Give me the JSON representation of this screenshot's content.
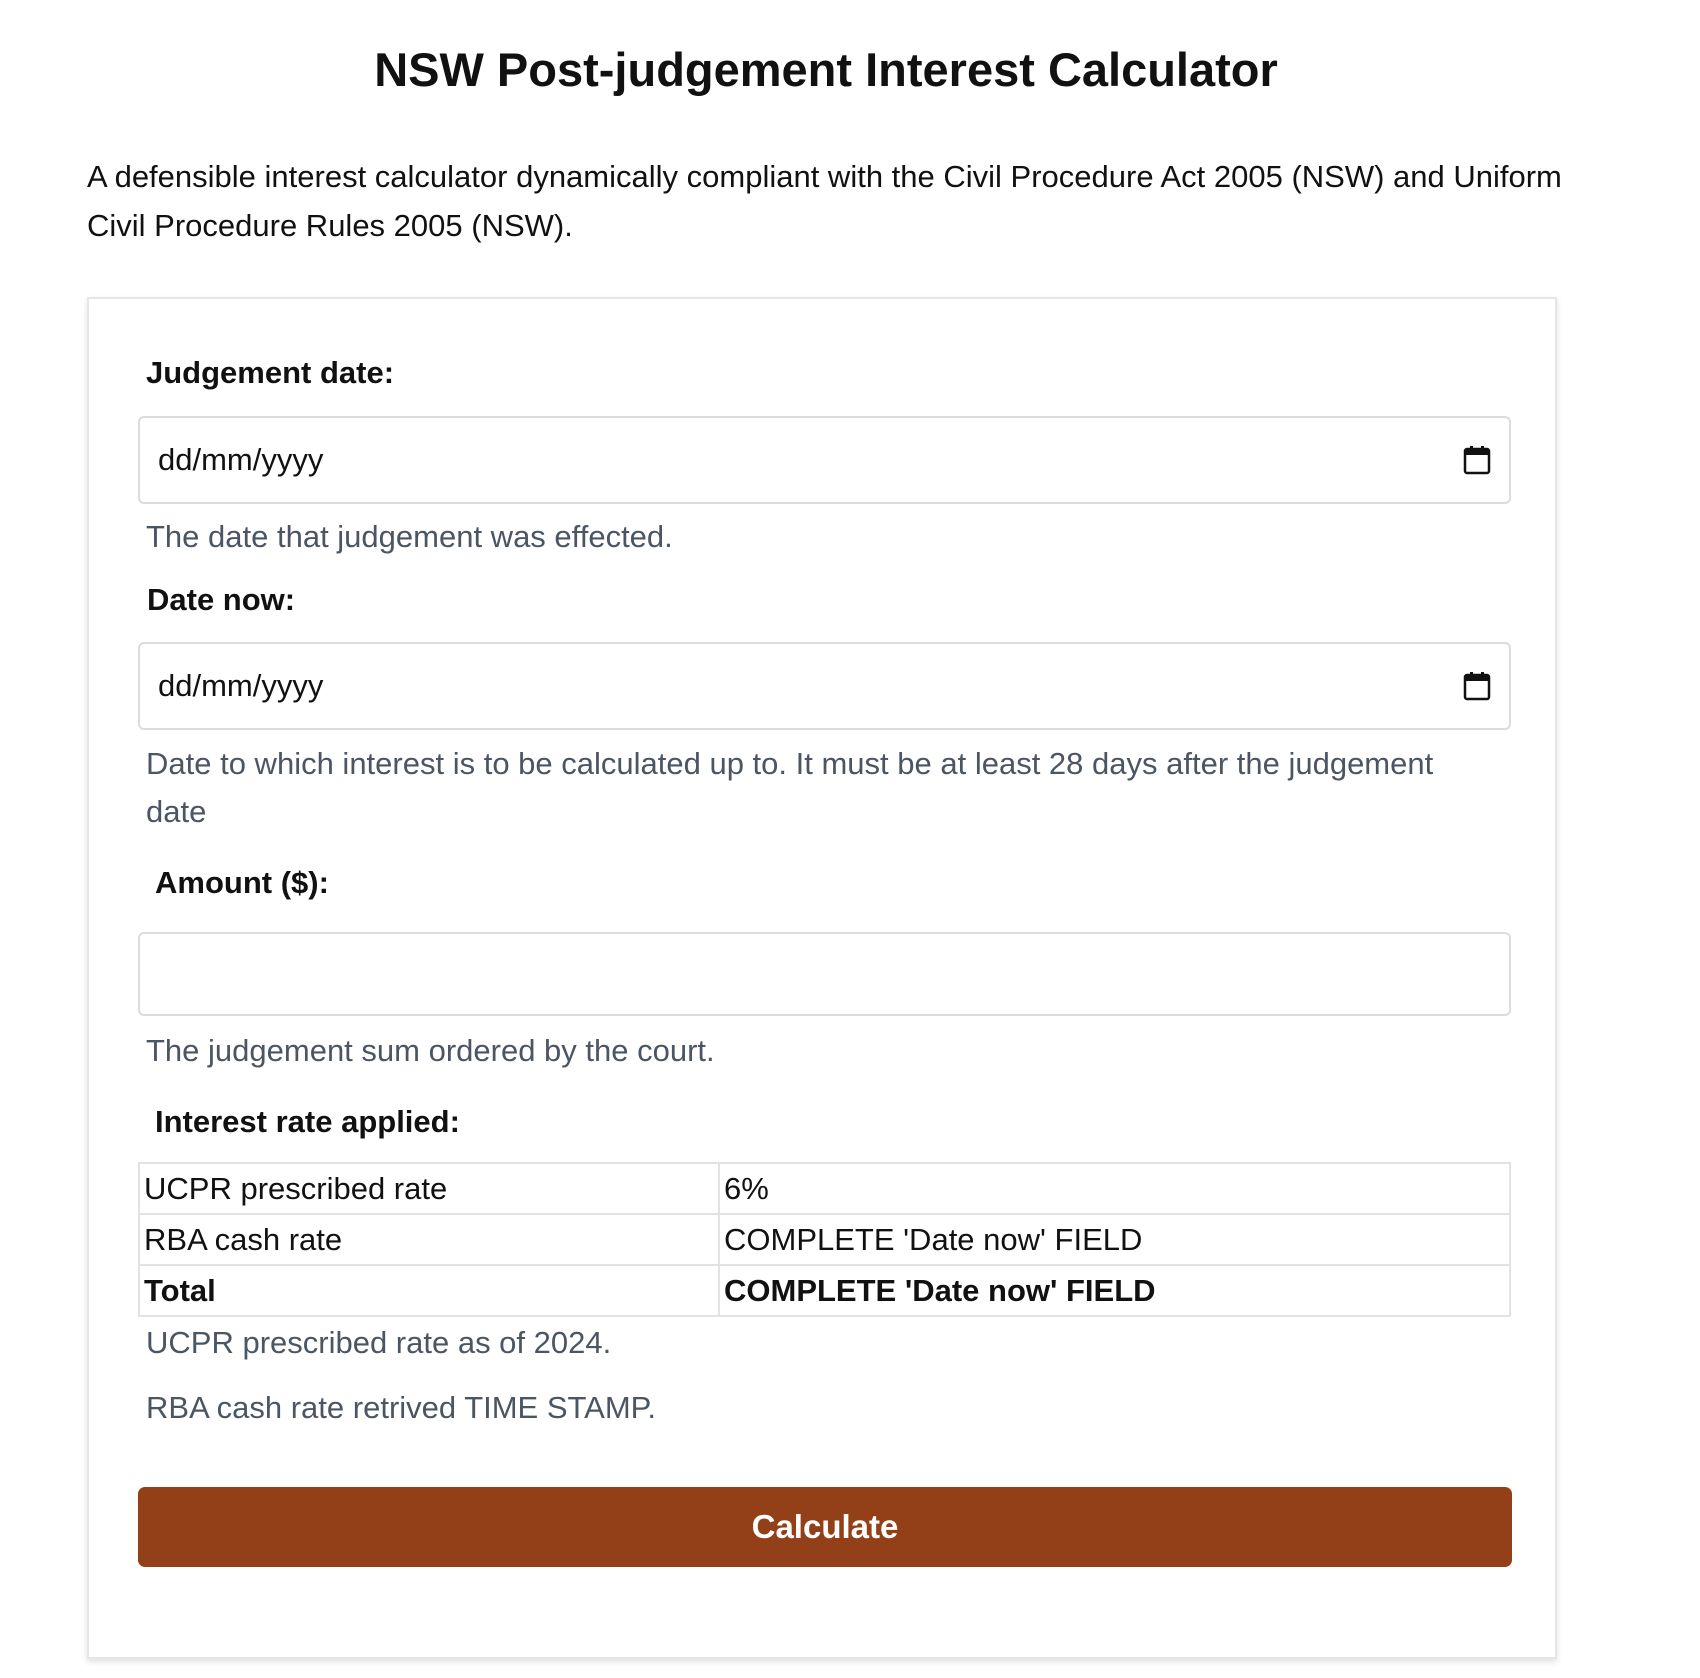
{
  "page": {
    "title": "NSW Post-judgement Interest Calculator",
    "intro": "A defensible interest calculator dynamically compliant with the Civil Procedure Act 2005 (NSW) and Uniform Civil Procedure Rules 2005 (NSW)."
  },
  "form": {
    "judgement_date": {
      "label": "Judgement date:",
      "placeholder": "dd/mm/yyyy",
      "help": "The date that judgement was effected."
    },
    "date_now": {
      "label": "Date now:",
      "placeholder": "dd/mm/yyyy",
      "help": "Date to which interest is to be calculated up to. It must be at least 28 days after the judgement date"
    },
    "amount": {
      "label": "Amount ($):",
      "value": "",
      "help": "The judgement sum ordered by the court."
    },
    "interest": {
      "label": "Interest rate applied:",
      "rows": [
        {
          "name": "UCPR prescribed rate",
          "value": "6%"
        },
        {
          "name": "RBA cash rate",
          "value": "COMPLETE 'Date now' FIELD"
        },
        {
          "name": "Total",
          "value": "COMPLETE 'Date now' FIELD"
        }
      ],
      "note_ucpr": "UCPR prescribed rate as of 2024.",
      "note_rba": "RBA cash rate retrived TIME STAMP."
    },
    "calculate_label": "Calculate"
  },
  "icons": {
    "date_picker": "calendar-icon"
  },
  "colors": {
    "button_bg": "#933f17",
    "help_text": "#4b5563"
  }
}
